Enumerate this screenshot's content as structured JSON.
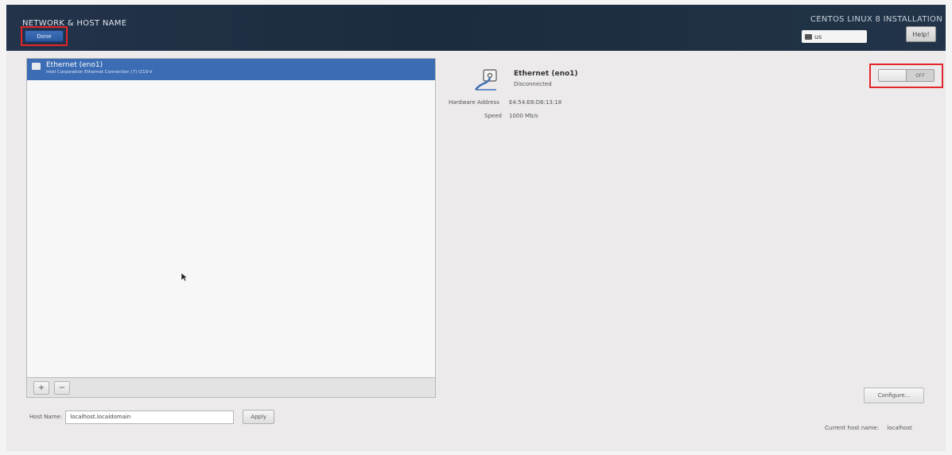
{
  "header": {
    "page_title": "NETWORK & HOST NAME",
    "done_label": "Done",
    "install_title": "CENTOS LINUX 8 INSTALLATION",
    "keyboard_layout": "us",
    "help_label": "Help!"
  },
  "devices": [
    {
      "name": "Ethernet (eno1)",
      "description": "Intel Corporation Ethernet Connection (7) I219-V",
      "selected": true
    }
  ],
  "list_toolbar": {
    "add_label": "+",
    "remove_label": "−"
  },
  "hostname": {
    "label": "Host Name:",
    "value": "localhost.localdomain",
    "apply_label": "Apply"
  },
  "details": {
    "title": "Ethernet (eno1)",
    "status": "Disconnected",
    "hw_label": "Hardware Address",
    "hw_value": "E4:54:E8:D6:13:18",
    "speed_label": "Speed",
    "speed_value": "1000 Mb/s",
    "toggle_state": "OFF",
    "configure_label": "Configure...",
    "current_host_label": "Current host name:",
    "current_host_value": "localhost"
  },
  "colors": {
    "accent": "#3b6cb4",
    "highlight": "#e2262b",
    "header": "#1e2a38"
  },
  "icons": {
    "device": "network-wired-icon",
    "keyboard": "keyboard-icon",
    "cursor": "mouse-pointer-icon"
  }
}
